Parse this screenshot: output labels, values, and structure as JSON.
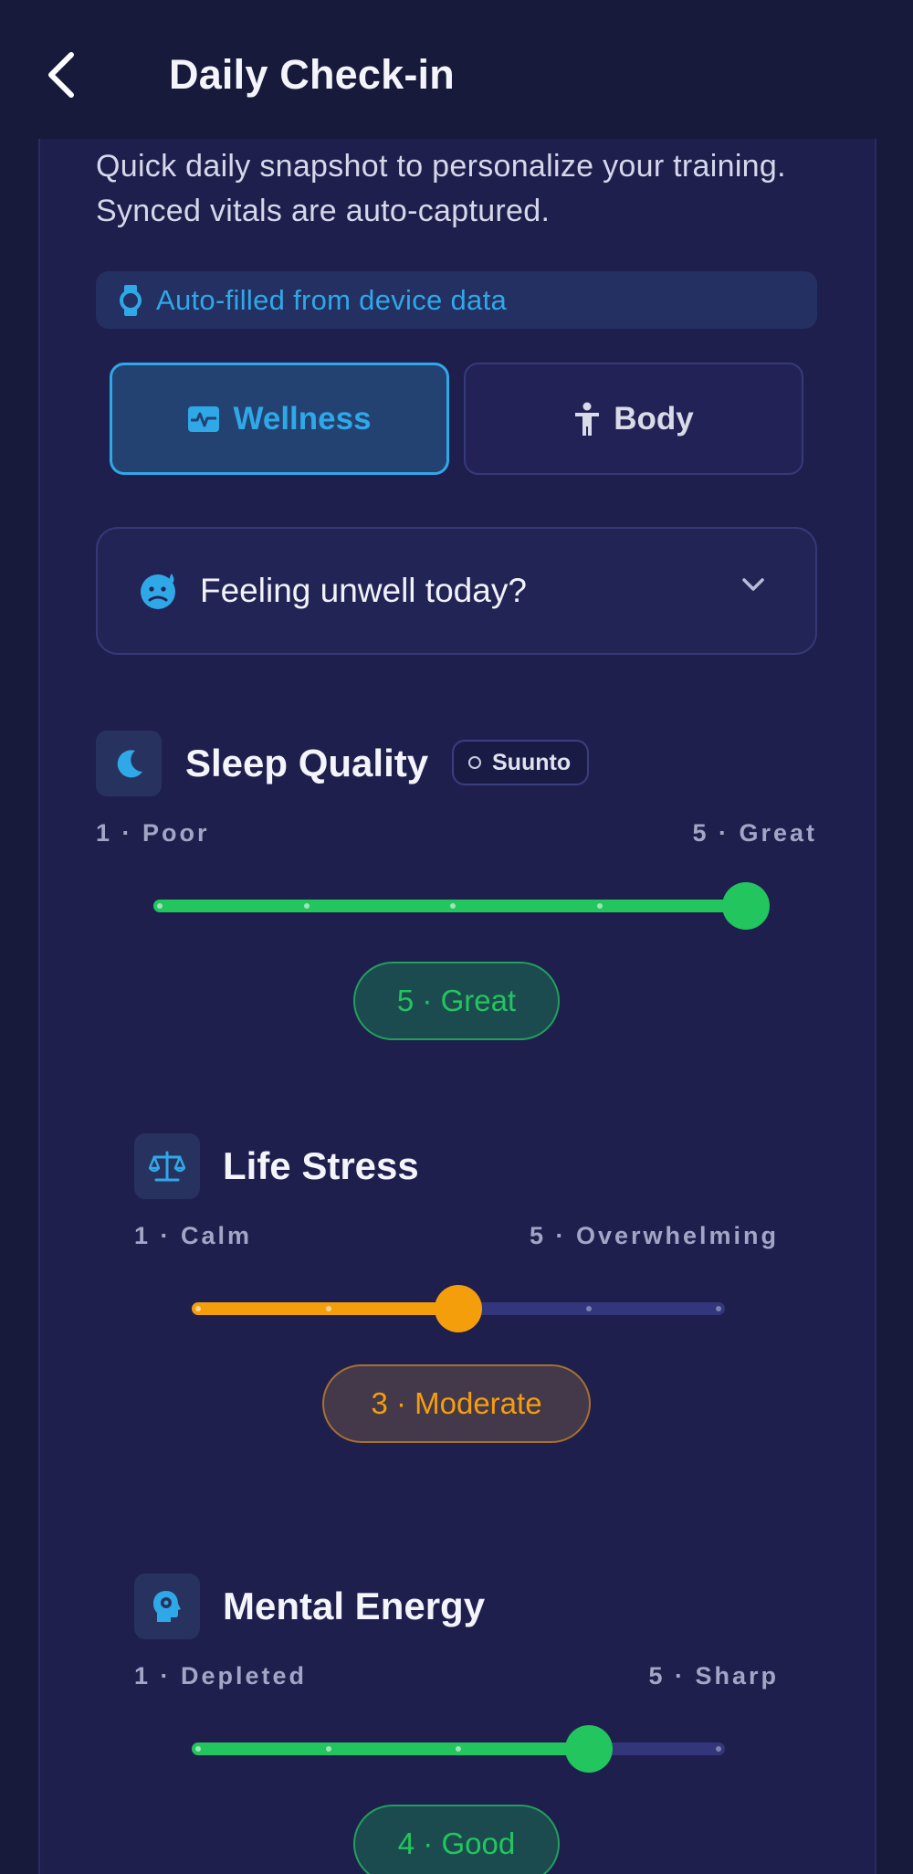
{
  "header": {
    "title": "Daily Check-in",
    "back_icon": "chevron-left-icon"
  },
  "intro": {
    "text": "Quick daily snapshot to personalize your training. Synced vitals are auto-captured."
  },
  "autofill_banner": {
    "text": "Auto-filled from device data",
    "icon": "watch-icon"
  },
  "tabs": [
    {
      "label": "Wellness",
      "icon": "heart-monitor-icon",
      "selected": true
    },
    {
      "label": "Body",
      "icon": "person-icon",
      "selected": false
    }
  ],
  "unwell": {
    "label": "Feeling unwell today?",
    "icon": "sick-face-icon",
    "chevron": "chevron-down-icon"
  },
  "metrics": {
    "sleep": {
      "title": "Sleep Quality",
      "icon": "moon-icon",
      "source": "Suunto",
      "min_label": "1 · Poor",
      "max_label": "5 · Great",
      "value": 5,
      "min": 1,
      "max": 5,
      "value_label": "5 · Great",
      "color": "#22c55e"
    },
    "stress": {
      "title": "Life Stress",
      "icon": "scale-icon",
      "min_label": "1 · Calm",
      "max_label": "5 · Overwhelming",
      "value": 3,
      "min": 1,
      "max": 5,
      "value_label": "3 · Moderate",
      "color": "#f59e0b"
    },
    "energy": {
      "title": "Mental Energy",
      "icon": "head-gear-icon",
      "min_label": "1 · Depleted",
      "max_label": "5 · Sharp",
      "value": 4,
      "min": 1,
      "max": 5,
      "value_label": "4 · Good",
      "color": "#22c55e"
    }
  },
  "colors": {
    "accent": "#2fa8e8",
    "background": "#1f1f4e",
    "header": "#181a3b",
    "track": "#33367a"
  }
}
